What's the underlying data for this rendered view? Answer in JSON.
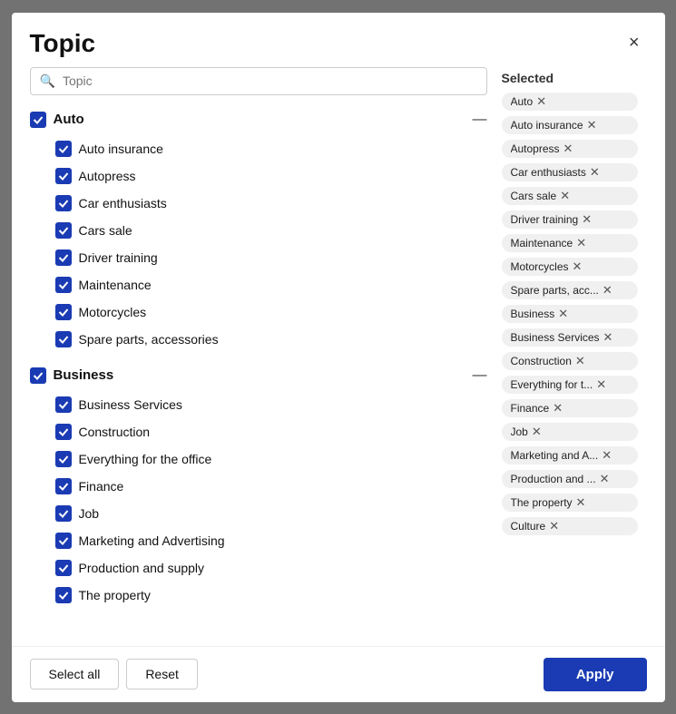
{
  "modal": {
    "title": "Topic",
    "close_label": "×"
  },
  "search": {
    "placeholder": "Topic"
  },
  "groups": [
    {
      "id": "auto",
      "label": "Auto",
      "checked": true,
      "items": [
        "Auto insurance",
        "Autopress",
        "Car enthusiasts",
        "Cars sale",
        "Driver training",
        "Maintenance",
        "Motorcycles",
        "Spare parts, accessories"
      ]
    },
    {
      "id": "business",
      "label": "Business",
      "checked": true,
      "items": [
        "Business Services",
        "Construction",
        "Everything for the office",
        "Finance",
        "Job",
        "Marketing and Advertising",
        "Production and supply",
        "The property"
      ]
    }
  ],
  "selected": {
    "label": "Selected",
    "tags": [
      "Auto",
      "Auto insurance",
      "Autopress",
      "Car enthusiasts",
      "Cars sale",
      "Driver training",
      "Maintenance",
      "Motorcycles",
      "Spare parts, acc...",
      "Business",
      "Business Services",
      "Construction",
      "Everything for t...",
      "Finance",
      "Job",
      "Marketing and A...",
      "Production and ...",
      "The property",
      "Culture"
    ]
  },
  "footer": {
    "select_all_label": "Select all",
    "reset_label": "Reset",
    "apply_label": "Apply"
  }
}
